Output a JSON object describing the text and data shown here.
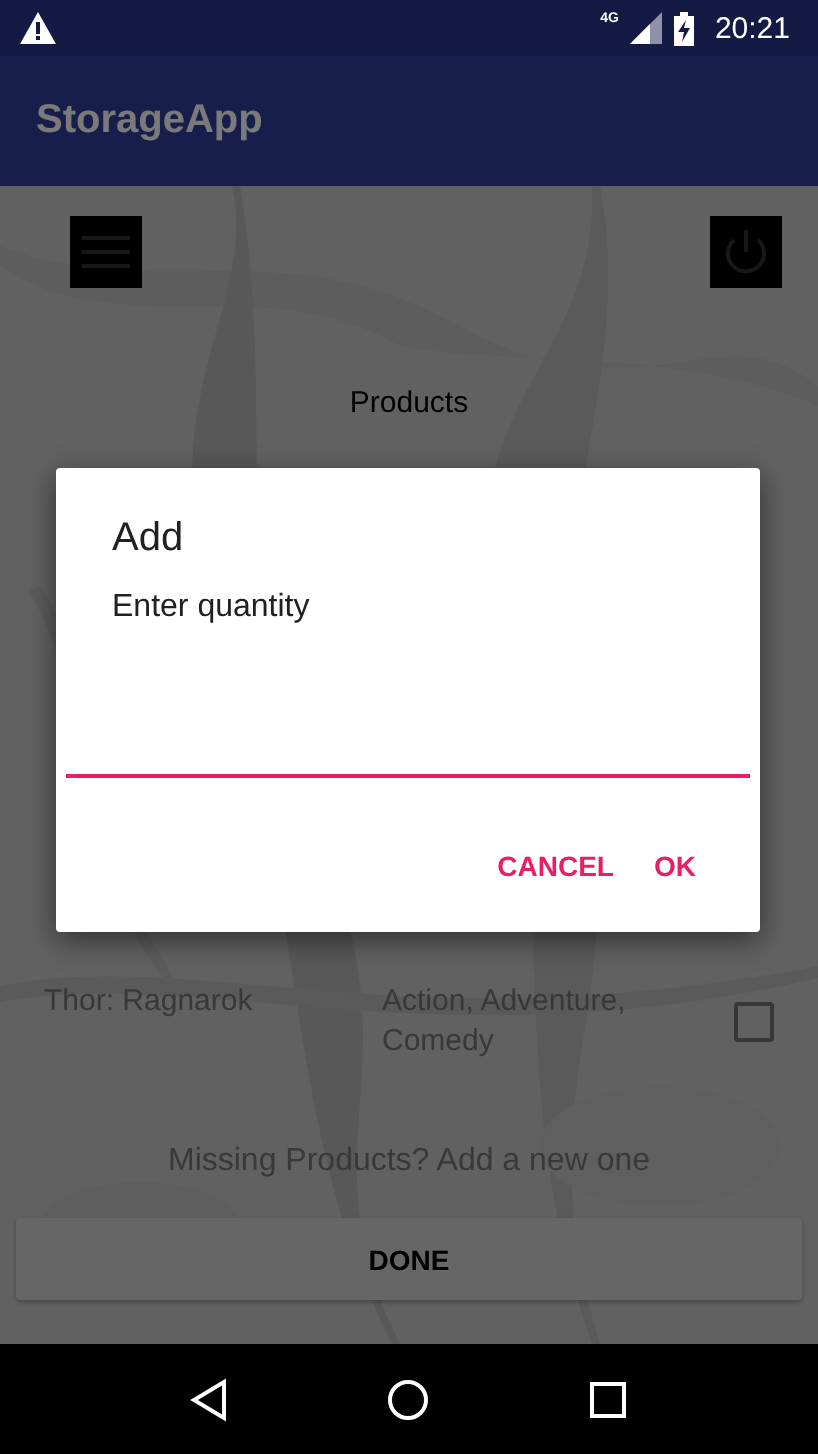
{
  "status_bar": {
    "time": "20:21",
    "network": "4G"
  },
  "app_bar": {
    "title": "StorageApp"
  },
  "content": {
    "heading": "Products",
    "rows": [
      {
        "name": "Thor: Ragnarok",
        "genre": "Action, Adventure, Comedy",
        "checked": false
      }
    ],
    "missing_link": "Missing Products? Add a new one",
    "done_button": "DONE"
  },
  "dialog": {
    "title": "Add",
    "message": "Enter quantity",
    "buttons": [
      "CANCEL",
      "OK"
    ]
  }
}
